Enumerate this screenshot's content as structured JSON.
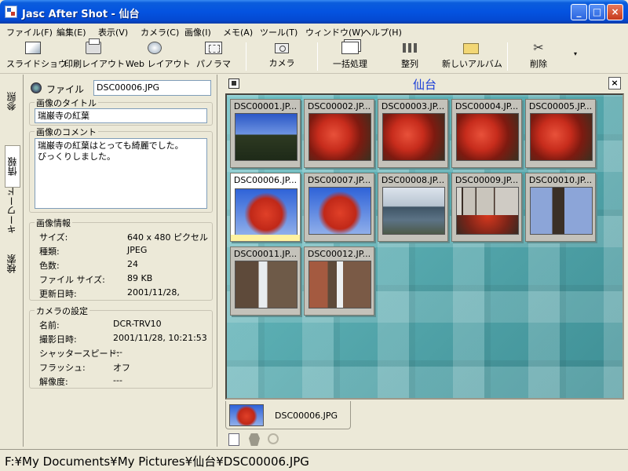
{
  "window": {
    "title": "Jasc After Shot - 仙台",
    "buttons": [
      "_",
      "□",
      "×"
    ]
  },
  "menu": [
    "ファイル(F)",
    "編集(E)",
    "表示(V)",
    "カメラ(C)",
    "画像(I)",
    "メモ(A)",
    "ツール(T)",
    "ウィンドウ(W)",
    "ヘルプ(H)"
  ],
  "toolbar": {
    "slideshow": "スライドショウ",
    "print_layout": "印刷レイアウト",
    "web_layout": "Web レイアウト",
    "panorama": "パノラマ",
    "camera": "カメラ",
    "batch": "一括処理",
    "arrange": "整列",
    "new_album": "新しいアルバム",
    "delete": "削除",
    "more": "▾"
  },
  "side_tabs": [
    "参照",
    "情報",
    "キーワード",
    "検索"
  ],
  "info": {
    "file_label": "ファイル",
    "file_value": "DSC00006.JPG",
    "title_group": "画像のタイトル",
    "title_value": "瑞巌寺の紅葉",
    "comment_group": "画像のコメント",
    "comment_value": "瑞巌寺の紅葉はとっても綺麗でした。\nびっくりしました。",
    "image_group": "画像情報",
    "image_rows": [
      {
        "k": "サイズ:",
        "v": "640 x 480 ピクセル"
      },
      {
        "k": "種類:",
        "v": "JPEG"
      },
      {
        "k": "色数:",
        "v": "24"
      },
      {
        "k": "ファイル サイズ:",
        "v": "89 KB"
      },
      {
        "k": "更新日時:",
        "v": "2001/11/28,"
      }
    ],
    "camera_group": "カメラの設定",
    "camera_rows": [
      {
        "k": "名前:",
        "v": "DCR-TRV10"
      },
      {
        "k": "撮影日時:",
        "v": "2001/11/28, 10:21:53"
      },
      {
        "k": "シャッタースピード:",
        "v": "---"
      },
      {
        "k": "フラッシュ:",
        "v": "オフ"
      },
      {
        "k": "解像度:",
        "v": "---"
      }
    ]
  },
  "gallery": {
    "folder": "仙台",
    "close": "×",
    "thumbnails": [
      {
        "name": "DSC00001.JP...",
        "pic": "p-sky"
      },
      {
        "name": "DSC00002.JP...",
        "pic": "p-red"
      },
      {
        "name": "DSC00003.JP...",
        "pic": "p-red"
      },
      {
        "name": "DSC00004.JP...",
        "pic": "p-red"
      },
      {
        "name": "DSC00005.JP...",
        "pic": "p-red"
      },
      {
        "name": "DSC00006.JP...",
        "pic": "p-redsky",
        "selected": true
      },
      {
        "name": "DSC00007.JP...",
        "pic": "p-redsky"
      },
      {
        "name": "DSC00008.JP...",
        "pic": "p-lake"
      },
      {
        "name": "DSC00009.JP...",
        "pic": "p-forest"
      },
      {
        "name": "DSC00010.JP...",
        "pic": "p-trunk"
      },
      {
        "name": "DSC00011.JP...",
        "pic": "p-fall"
      },
      {
        "name": "DSC00012.JP...",
        "pic": "p-fall2"
      }
    ]
  },
  "tray": {
    "item": "DSC00006.JPG"
  },
  "status": "F:¥My Documents¥My Pictures¥仙台¥DSC00006.JPG"
}
